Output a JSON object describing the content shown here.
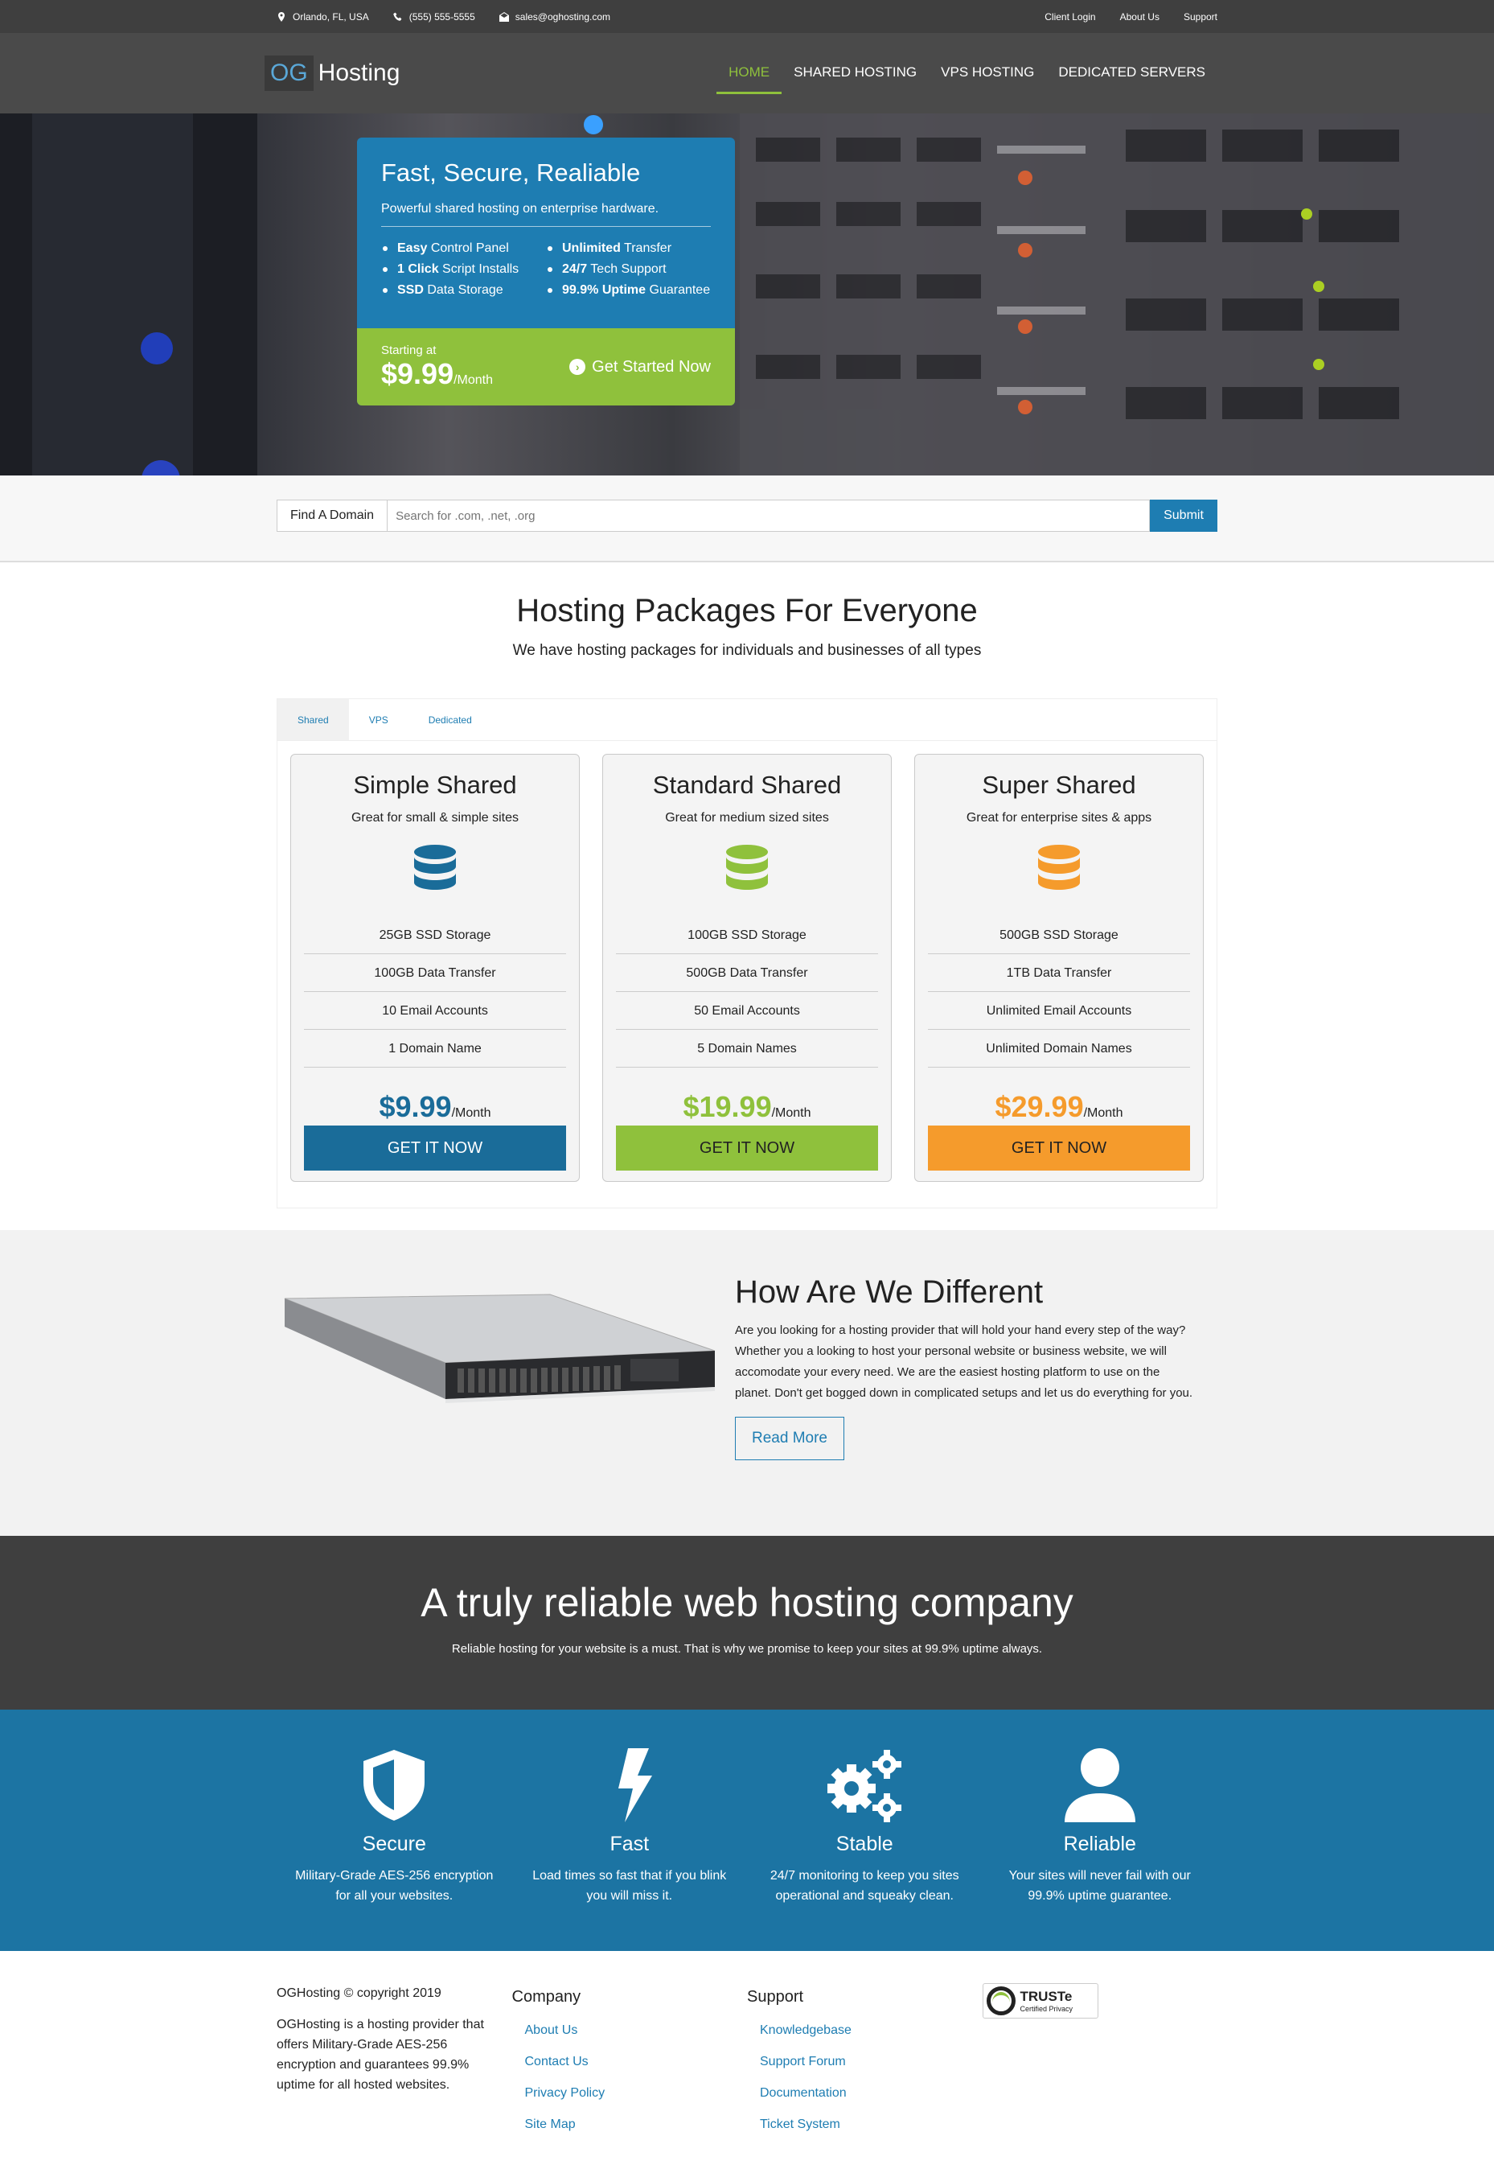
{
  "topbar": {
    "location": "Orlando, FL, USA",
    "phone": "(555) 555-5555",
    "email": "sales@oghosting.com",
    "links": [
      "Client Login",
      "About Us",
      "Support"
    ]
  },
  "header": {
    "logo_og": "OG",
    "logo_name": "Hosting",
    "nav": [
      "HOME",
      "SHARED HOSTING",
      "VPS HOSTING",
      "DEDICATED SERVERS"
    ]
  },
  "hero": {
    "title": "Fast, Secure, Realiable",
    "subtitle": "Powerful shared hosting on enterprise hardware.",
    "features_left": [
      {
        "bold": "Easy",
        "rest": " Control Panel"
      },
      {
        "bold": "1 Click",
        "rest": " Script Installs"
      },
      {
        "bold": "SSD",
        "rest": " Data Storage"
      }
    ],
    "features_right": [
      {
        "bold": "Unlimited",
        "rest": " Transfer"
      },
      {
        "bold": "24/7",
        "rest": " Tech Support"
      },
      {
        "bold": "99.9% Uptime",
        "rest": " Guarantee"
      }
    ],
    "starting_label": "Starting at",
    "price": "$9.99",
    "price_unit": "/Month",
    "cta": "Get Started Now"
  },
  "domain": {
    "label": "Find A Domain",
    "placeholder": "Search for .com, .net, .org",
    "submit": "Submit"
  },
  "packages": {
    "title": "Hosting Packages For Everyone",
    "lead": "We have hosting packages for individuals and businesses of all types",
    "tabs": [
      "Shared",
      "VPS",
      "Dedicated"
    ],
    "plans": [
      {
        "name": "Simple Shared",
        "desc": "Great for small & simple sites",
        "items": [
          "25GB SSD Storage",
          "100GB Data Transfer",
          "10 Email Accounts",
          "1 Domain Name"
        ],
        "price": "$9.99",
        "unit": "/Month",
        "cta": "GET IT NOW",
        "color": "#1a6c99"
      },
      {
        "name": "Standard Shared",
        "desc": "Great for medium sized sites",
        "items": [
          "100GB SSD Storage",
          "500GB Data Transfer",
          "50 Email Accounts",
          "5 Domain Names"
        ],
        "price": "$19.99",
        "unit": "/Month",
        "cta": "GET IT NOW",
        "color": "#8fc13c"
      },
      {
        "name": "Super Shared",
        "desc": "Great for enterprise sites & apps",
        "items": [
          "500GB SSD Storage",
          "1TB Data Transfer",
          "Unlimited Email Accounts",
          "Unlimited Domain Names"
        ],
        "price": "$29.99",
        "unit": "/Month",
        "cta": "GET IT NOW",
        "color": "#f59b2c"
      }
    ]
  },
  "different": {
    "title": "How Are We Different",
    "body": "Are you looking for a hosting provider that will hold your hand every step of the way? Whether you a looking to host your personal website or business website, we will accomodate your every need. We are the easiest hosting platform to use on the planet. Don't get bogged down in complicated setups and let us do everything for you.",
    "cta": "Read More"
  },
  "reliable": {
    "title": "A truly reliable web hosting company",
    "body": "Reliable hosting for your website is a must. That is why we promise to keep your sites at 99.9% uptime always."
  },
  "features": [
    {
      "icon": "shield-icon",
      "title": "Secure",
      "line1": "Military-Grade AES-256 encryption",
      "line2": "for all your websites."
    },
    {
      "icon": "bolt-icon",
      "title": "Fast",
      "line1": "Load times so fast that if you blink",
      "line2": "you will miss it."
    },
    {
      "icon": "cogs-icon",
      "title": "Stable",
      "line1": "24/7 monitoring to keep you sites",
      "line2": "operational and squeaky clean."
    },
    {
      "icon": "user-icon",
      "title": "Reliable",
      "line1": "Your sites will never fail with our",
      "line2": "99.9% uptime guarantee."
    }
  ],
  "footer": {
    "copyright": "OGHosting © copyright 2019",
    "about": "OGHosting is a hosting provider that offers Military-Grade AES-256 encryption and guarantees 99.9% uptime for all hosted websites.",
    "company_title": "Company",
    "company_links": [
      "About Us",
      "Contact Us",
      "Privacy Policy",
      "Site Map"
    ],
    "support_title": "Support",
    "support_links": [
      "Knowledgebase",
      "Support Forum",
      "Documentation",
      "Ticket System"
    ],
    "badge_title": "TRUSTe",
    "badge_sub": "Certified Privacy"
  }
}
